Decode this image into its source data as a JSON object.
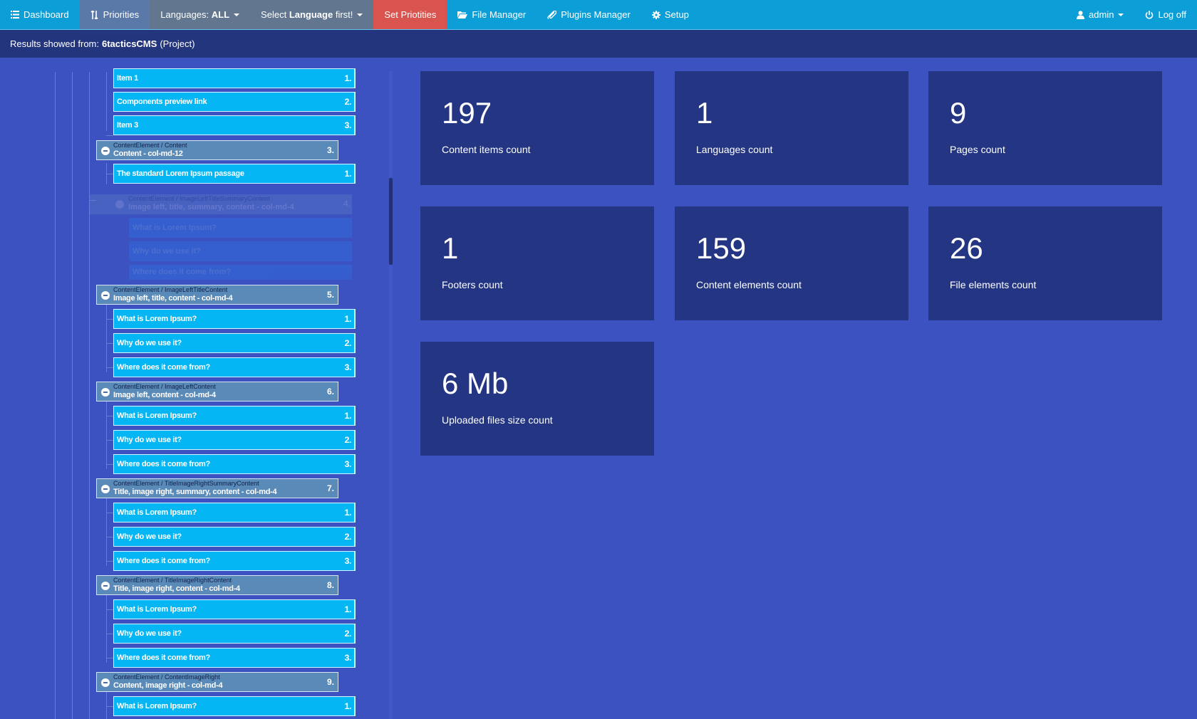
{
  "nav": {
    "dashboard": "Dashboard",
    "priorities": "Priorities",
    "languages_prefix": "Languages:",
    "languages_value": "ALL",
    "select_prefix": "Select",
    "select_bold": "Language",
    "select_suffix": "first!",
    "set_priorities": "Set Priotities",
    "file_manager": "File Manager",
    "plugins_manager": "Plugins Manager",
    "setup": "Setup",
    "user": "admin",
    "logoff": "Log off"
  },
  "subheader": {
    "prefix": "Results showed from:",
    "project": "6tacticsCMS",
    "suffix": "(Project)"
  },
  "tree": {
    "top_items": [
      {
        "label": "Item 1",
        "num": "1."
      },
      {
        "label": "Components preview link",
        "num": "2."
      },
      {
        "label": "Item 3",
        "num": "3."
      }
    ],
    "groups": [
      {
        "type": "ContentElement / Content",
        "title": "Content - col-md-12",
        "num": "3.",
        "items": [
          {
            "label": "The standard Lorem Ipsum passage",
            "num": "1."
          }
        ]
      },
      {
        "type": "ContentElement / ImageLeftTitleContent",
        "title": "Image left, title, content - col-md-4",
        "num": "5.",
        "items": [
          {
            "label": "What is Lorem Ipsum?",
            "num": "1."
          },
          {
            "label": "Why do we use it?",
            "num": "2."
          },
          {
            "label": "Where does it come from?",
            "num": "3."
          }
        ]
      },
      {
        "type": "ContentElement / ImageLeftContent",
        "title": "Image left, content - col-md-4",
        "num": "6.",
        "items": [
          {
            "label": "What is Lorem Ipsum?",
            "num": "1."
          },
          {
            "label": "Why do we use it?",
            "num": "2."
          },
          {
            "label": "Where does it come from?",
            "num": "3."
          }
        ]
      },
      {
        "type": "ContentElement / TitleImageRightSummaryContent",
        "title": "Title, image right, summary, content - col-md-4",
        "num": "7.",
        "items": [
          {
            "label": "What is Lorem Ipsum?",
            "num": "1."
          },
          {
            "label": "Why do we use it?",
            "num": "2."
          },
          {
            "label": "Where does it come from?",
            "num": "3."
          }
        ]
      },
      {
        "type": "ContentElement / TitleImageRightContent",
        "title": "Title, image right, content - col-md-4",
        "num": "8.",
        "items": [
          {
            "label": "What is Lorem Ipsum?",
            "num": "1."
          },
          {
            "label": "Why do we use it?",
            "num": "2."
          },
          {
            "label": "Where does it come from?",
            "num": "3."
          }
        ]
      },
      {
        "type": "ContentElement / ContentImageRight",
        "title": "Content, image right - col-md-4",
        "num": "9.",
        "items": [
          {
            "label": "What is Lorem Ipsum?",
            "num": "1."
          }
        ]
      }
    ],
    "dragging": {
      "type": "ContentElement / ImageLeftTitleSummaryContent",
      "title": "Image left, title, summary, content - col-md-4",
      "num": "4.",
      "items": [
        "What is Lorem Ipsum?",
        "Why do we use it?",
        "Where does it come from?"
      ]
    }
  },
  "stats": [
    {
      "value": "197",
      "label": "Content items count"
    },
    {
      "value": "1",
      "label": "Languages count"
    },
    {
      "value": "9",
      "label": "Pages count"
    },
    {
      "value": "1",
      "label": "Footers count"
    },
    {
      "value": "159",
      "label": "Content elements count"
    },
    {
      "value": "26",
      "label": "File elements count"
    },
    {
      "value": "6 Mb",
      "label": "Uploaded files size count"
    }
  ]
}
